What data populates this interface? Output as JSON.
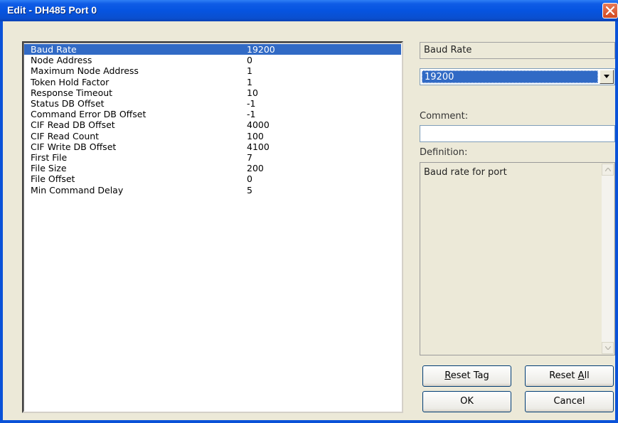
{
  "window": {
    "title": "Edit - DH485 Port 0"
  },
  "list": {
    "selected_index": 0,
    "rows": [
      {
        "name": "Baud Rate",
        "value": "19200"
      },
      {
        "name": "Node Address",
        "value": "0"
      },
      {
        "name": "Maximum Node Address",
        "value": "1"
      },
      {
        "name": "Token Hold Factor",
        "value": "1"
      },
      {
        "name": "Response Timeout",
        "value": "10"
      },
      {
        "name": "Status DB Offset",
        "value": "-1"
      },
      {
        "name": "Command Error DB Offset",
        "value": "-1"
      },
      {
        "name": "CIF Read DB Offset",
        "value": "4000"
      },
      {
        "name": "CIF Read Count",
        "value": "100"
      },
      {
        "name": "CIF Write DB Offset",
        "value": "4100"
      },
      {
        "name": "First File",
        "value": "7"
      },
      {
        "name": "File Size",
        "value": "200"
      },
      {
        "name": "File Offset",
        "value": "0"
      },
      {
        "name": "Min Command Delay",
        "value": "5"
      }
    ]
  },
  "panel": {
    "param_name": "Baud Rate",
    "selected_value": "19200",
    "comment_label": "Comment:",
    "comment_value": "",
    "definition_label": "Definition:",
    "definition_text": "Baud rate for port"
  },
  "buttons": {
    "reset_tag_pre": "",
    "reset_tag_key": "R",
    "reset_tag_post": "eset Tag",
    "reset_all_pre": "Reset ",
    "reset_all_key": "A",
    "reset_all_post": "ll",
    "ok": "OK",
    "cancel": "Cancel"
  },
  "icons": {
    "close": "close-icon",
    "dropdown": "chevron-down-icon",
    "scroll_up": "scroll-up-icon",
    "scroll_down": "scroll-down-icon"
  },
  "colors": {
    "title_bar": "#0a52d8",
    "selection": "#316ac5",
    "close_button": "#d24a22"
  }
}
